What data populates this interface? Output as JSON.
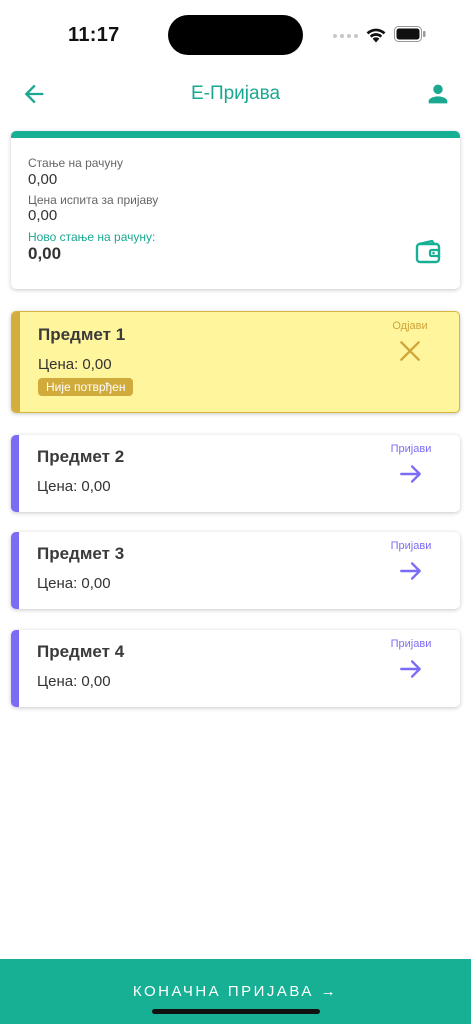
{
  "status_bar": {
    "time": "11:17"
  },
  "header": {
    "title": "Е-Пријава"
  },
  "balance": {
    "current_label": "Стање на рачуну",
    "current_value": "0,00",
    "exam_price_label": "Цена испита за пријаву",
    "exam_price_value": "0,00",
    "new_label": "Ново стање на рачуну:",
    "new_value": "0,00"
  },
  "subjects": [
    {
      "name": "Предмет 1",
      "price": "Цена: 0,00",
      "status": "Није потврђен",
      "action": "Одјави"
    },
    {
      "name": "Предмет 2",
      "price": "Цена: 0,00",
      "action": "Пријави"
    },
    {
      "name": "Предмет 3",
      "price": "Цена: 0,00",
      "action": "Пријави"
    },
    {
      "name": "Предмет 4",
      "price": "Цена: 0,00",
      "action": "Пријави"
    }
  ],
  "footer": {
    "final_label": "КОНАЧНА ПРИЈАВА →"
  },
  "colors": {
    "accent": "#17b095",
    "register": "#7b6cf6",
    "selected_bg": "#fff59d",
    "selected_accent": "#d4ad3f"
  }
}
